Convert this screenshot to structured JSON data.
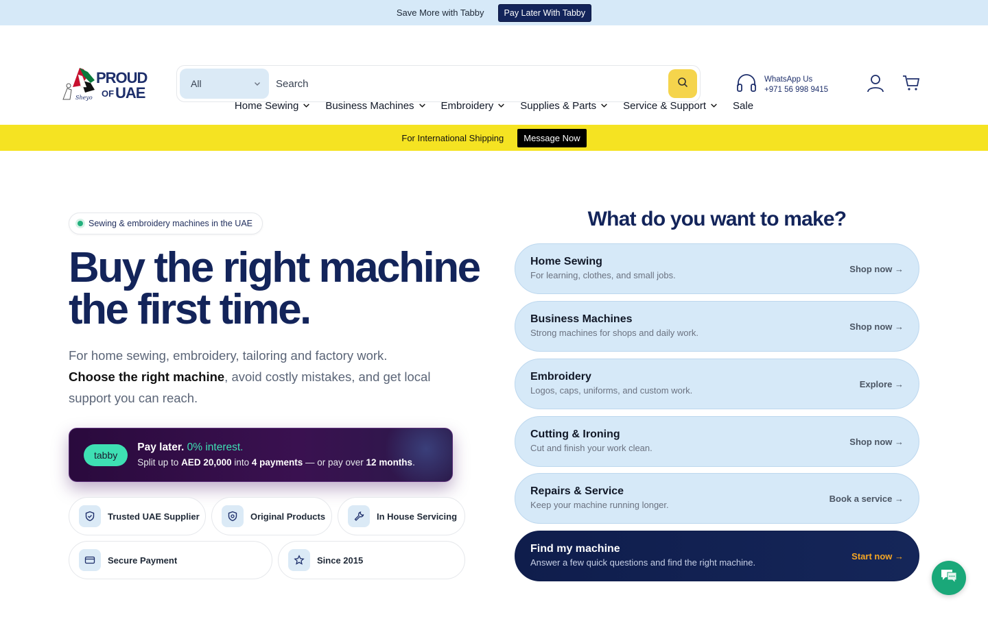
{
  "topbar": {
    "text": "Save More with Tabby",
    "button": "Pay Later With Tabby"
  },
  "logo": {
    "line1": "PROUD",
    "line2": "OF UAE"
  },
  "search": {
    "category": "All",
    "placeholder": "Search"
  },
  "contact": {
    "label": "WhatsApp Us",
    "phone": "+971 56 998 9415"
  },
  "nav": [
    {
      "label": "Home Sewing"
    },
    {
      "label": "Business Machines"
    },
    {
      "label": "Embroidery"
    },
    {
      "label": "Supplies & Parts"
    },
    {
      "label": "Service & Support"
    },
    {
      "label": "Sale"
    }
  ],
  "promo_bar": {
    "text": "For International Shipping",
    "button": "Message Now"
  },
  "hero": {
    "pill": "Sewing & embroidery machines in the UAE",
    "title_line1": "Buy the right machine",
    "title_line2": "the first time.",
    "sub_line1": "For home sewing, embroidery, tailoring and factory work.",
    "sub_bold": "Choose the right machine",
    "sub_rest": ", avoid costly mistakes, and get local support you can reach."
  },
  "tabby": {
    "badge": "tabby",
    "l1_a": "Pay later.",
    "l1_b": "0% interest.",
    "l2_a": "Split up to",
    "l2_amount": "AED 20,000",
    "l2_b": "into",
    "l2_payments": "4 payments",
    "l2_c": "— or pay over",
    "l2_months": "12 months",
    "l2_d": "."
  },
  "trust": [
    {
      "label": "Trusted UAE Supplier",
      "icon": "shield-check-icon"
    },
    {
      "label": "Original Products",
      "icon": "shield-icon"
    },
    {
      "label": "In House Servicing",
      "icon": "wrench-icon"
    },
    {
      "label": "Secure Payment",
      "icon": "card-icon"
    },
    {
      "label": "Since 2015",
      "icon": "star-icon"
    }
  ],
  "make": {
    "title": "What do you want to make?",
    "items": [
      {
        "title": "Home Sewing",
        "desc": "For learning, clothes, and small jobs.",
        "cta": "Shop now →"
      },
      {
        "title": "Business Machines",
        "desc": "Strong machines for shops and daily work.",
        "cta": "Shop now →"
      },
      {
        "title": "Embroidery",
        "desc": "Logos, caps, uniforms, and custom work.",
        "cta": "Explore →"
      },
      {
        "title": "Cutting & Ironing",
        "desc": "Cut and finish your work clean.",
        "cta": "Shop now →"
      },
      {
        "title": "Repairs & Service",
        "desc": "Keep your machine running longer.",
        "cta": "Book a service →"
      },
      {
        "title": "Find my machine",
        "desc": "Answer a few quick questions and find the right machine.",
        "cta": "Start now →"
      }
    ]
  },
  "colors": {
    "navy": "#13245a",
    "accent_yellow": "#f5e322",
    "tabby_green": "#3ee0b3",
    "light_blue": "#d6e9f8"
  }
}
